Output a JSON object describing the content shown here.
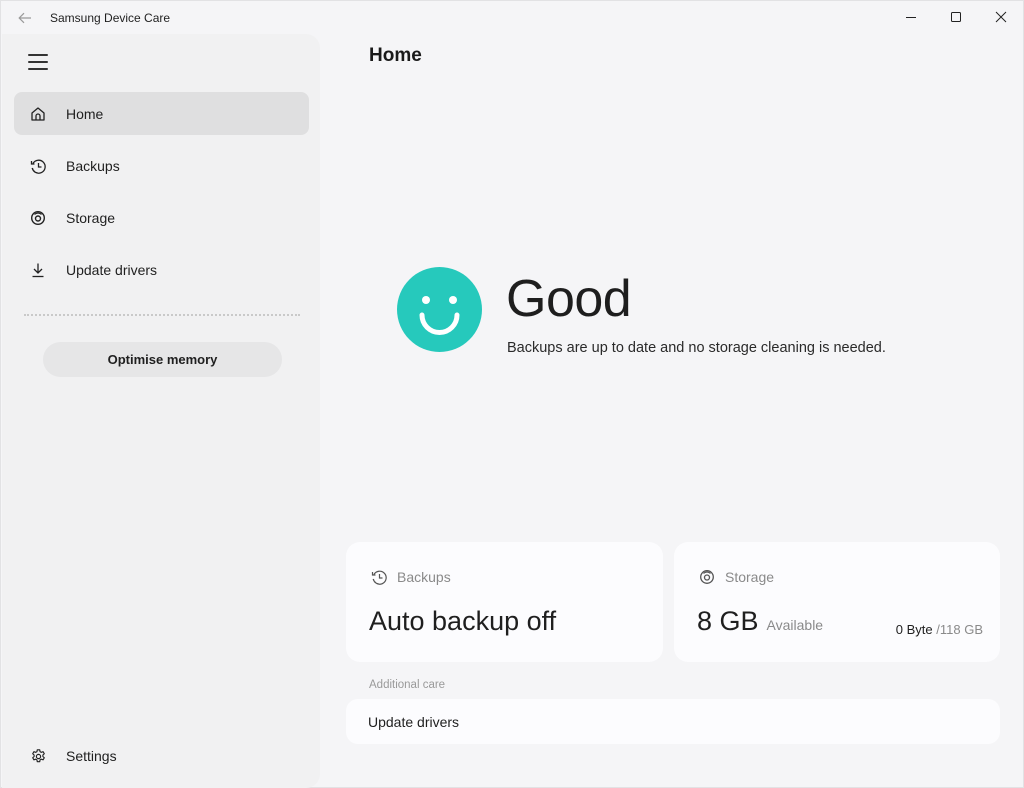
{
  "window": {
    "title": "Samsung Device Care",
    "controls": [
      "minimize",
      "maximize",
      "close"
    ]
  },
  "sidebar": {
    "menu_icon": "hamburger-icon",
    "items": [
      {
        "label": "Home",
        "icon": "home-icon",
        "active": true
      },
      {
        "label": "Backups",
        "icon": "backup-history-icon",
        "active": false
      },
      {
        "label": "Storage",
        "icon": "storage-disc-icon",
        "active": false
      },
      {
        "label": "Update drivers",
        "icon": "download-icon",
        "active": false
      }
    ],
    "optimise_button": "Optimise memory",
    "settings": {
      "label": "Settings",
      "icon": "gear-icon"
    }
  },
  "main": {
    "page_title": "Home",
    "status": {
      "title": "Good",
      "description": "Backups are up to date and no storage cleaning is needed.",
      "icon": "smiley-face-icon",
      "color": "#26c9bc"
    },
    "cards": {
      "backups": {
        "label": "Backups",
        "value": "Auto backup off"
      },
      "storage": {
        "label": "Storage",
        "value": "8 GB",
        "value_sub": "Available",
        "used": "0 Byte",
        "total": "/118 GB"
      }
    },
    "additional_care": {
      "label": "Additional care",
      "items": [
        {
          "label": "Update drivers"
        }
      ]
    }
  }
}
